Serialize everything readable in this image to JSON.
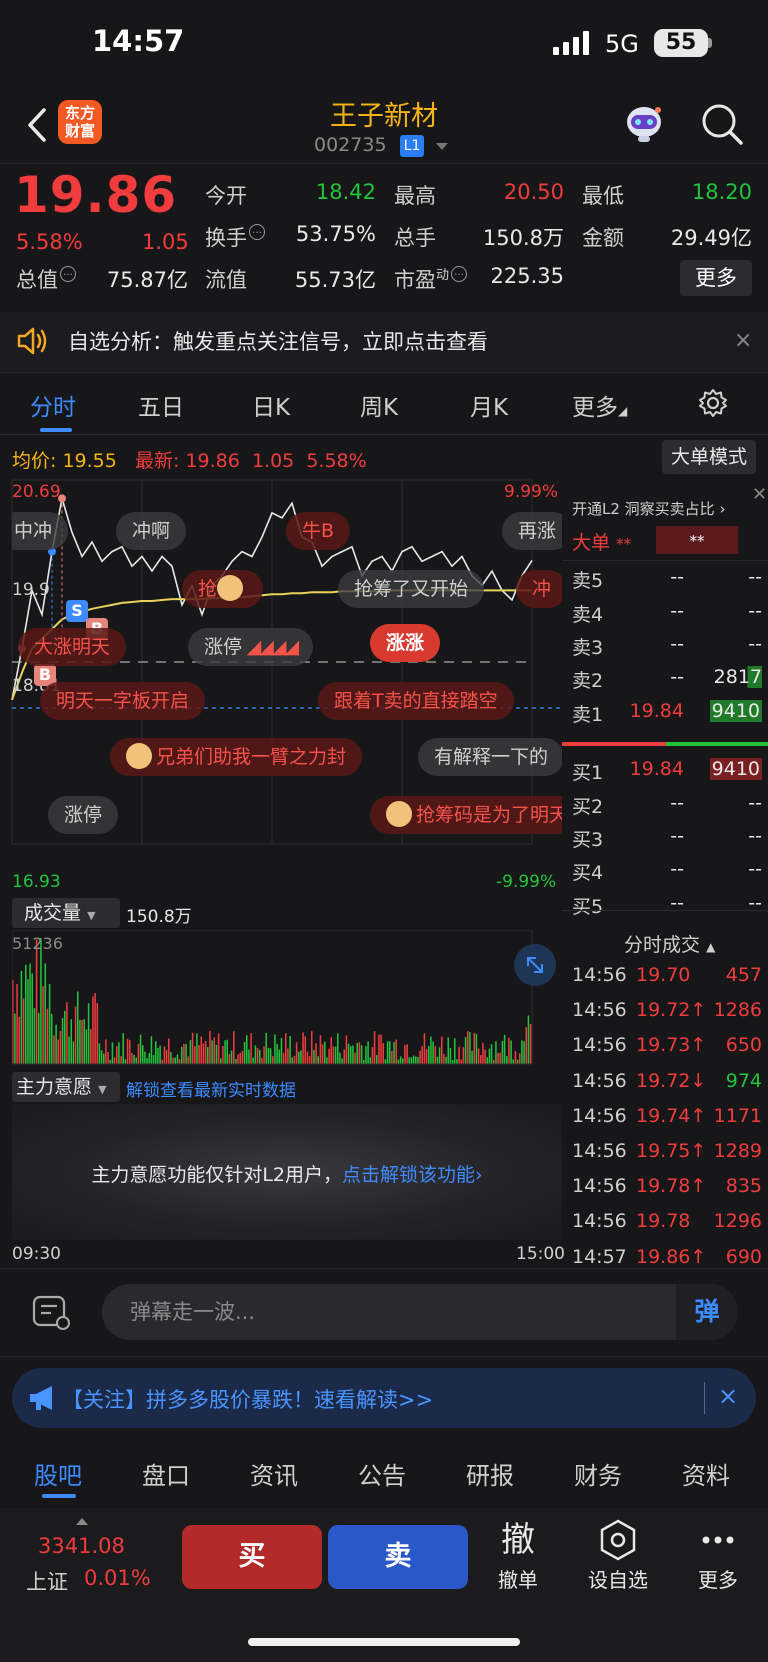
{
  "status_bar": {
    "time": "14:57",
    "network": "5G",
    "battery": "55"
  },
  "header": {
    "logo_text_1": "东方",
    "logo_text_2": "财富",
    "stock_name": "王子新材",
    "stock_code": "002735",
    "level_badge": "L1"
  },
  "quote": {
    "price": "19.86",
    "change_pct": "5.58%",
    "change": "1.05",
    "fields": [
      {
        "label": "今开",
        "value": "18.42"
      },
      {
        "label": "最高",
        "value": "20.50"
      },
      {
        "label": "最低",
        "value": "18.20"
      },
      {
        "label": "换手",
        "value": "53.75%"
      },
      {
        "label": "总手",
        "value": "150.8万"
      },
      {
        "label": "金额",
        "value": "29.49亿"
      },
      {
        "label": "总值",
        "value": "75.87亿"
      },
      {
        "label": "流值",
        "value": "55.73亿"
      },
      {
        "label": "市盈",
        "sup": "动",
        "value": "225.35"
      }
    ],
    "more_label": "更多"
  },
  "banner": {
    "text": "自选分析：触发重点关注信号，立即点击查看",
    "close": "×"
  },
  "chart_tabs": [
    "分时",
    "五日",
    "日K",
    "周K",
    "月K",
    "更多"
  ],
  "intraday": {
    "avg_label": "均价:",
    "avg_value": "19.55",
    "latest_label": "最新:",
    "latest_value": "19.86",
    "latest_change": "1.05",
    "latest_pct": "5.58%",
    "big_order_mode": "大单模式",
    "y_max": "20.69",
    "y_min": "16.93",
    "pct_max": "9.99%",
    "pct_min": "-9.99%",
    "y_mid": "19.9",
    "y_ref": "18.81",
    "time_start": "09:30",
    "time_end": "15:00",
    "markers": [
      "B",
      "S",
      "B"
    ]
  },
  "danmaku": [
    {
      "text": "中冲",
      "style": "gray"
    },
    {
      "text": "冲啊",
      "style": "gray"
    },
    {
      "text": "牛B",
      "style": "red"
    },
    {
      "text": "再涨",
      "style": "gray"
    },
    {
      "text": "抢",
      "style": "red"
    },
    {
      "text": "抢筹了又开始",
      "style": "gray"
    },
    {
      "text": "冲",
      "style": "red"
    },
    {
      "text": "大涨明天",
      "style": "red"
    },
    {
      "text": "涨停",
      "style": "gray"
    },
    {
      "text": "涨涨",
      "style": "red"
    },
    {
      "text": "明天一字板开启",
      "style": "red"
    },
    {
      "text": "跟着T卖的直接踏空",
      "style": "red"
    },
    {
      "text": "兄弟们助我一臂之力封",
      "style": "red"
    },
    {
      "text": "有解释一下的",
      "style": "gray"
    },
    {
      "text": "涨停",
      "style": "gray"
    },
    {
      "text": "抢筹码是为了明天",
      "style": "red"
    }
  ],
  "l2_panel": {
    "title": "开通L2 洞察买卖占比",
    "big_order_label": "大单",
    "big_order_v1": "**",
    "big_order_v2": "**"
  },
  "order_book": {
    "asks": [
      {
        "label": "卖5",
        "price": "--",
        "vol": "--"
      },
      {
        "label": "卖4",
        "price": "--",
        "vol": "--"
      },
      {
        "label": "卖3",
        "price": "--",
        "vol": "--"
      },
      {
        "label": "卖2",
        "price": "--",
        "vol": "2817"
      },
      {
        "label": "卖1",
        "price": "19.84",
        "vol": "9410"
      }
    ],
    "bids": [
      {
        "label": "买1",
        "price": "19.84",
        "vol": "9410"
      },
      {
        "label": "买2",
        "price": "--",
        "vol": "--"
      },
      {
        "label": "买3",
        "price": "--",
        "vol": "--"
      },
      {
        "label": "买4",
        "price": "--",
        "vol": "--"
      },
      {
        "label": "买5",
        "price": "--",
        "vol": "--"
      }
    ]
  },
  "ticks": {
    "title": "分时成交",
    "rows": [
      {
        "time": "14:56",
        "price": "19.70",
        "vol": "457",
        "pc": "red",
        "vc": "red"
      },
      {
        "time": "14:56",
        "price": "19.72↑",
        "vol": "1286",
        "pc": "red",
        "vc": "red"
      },
      {
        "time": "14:56",
        "price": "19.73↑",
        "vol": "650",
        "pc": "red",
        "vc": "red"
      },
      {
        "time": "14:56",
        "price": "19.72↓",
        "vol": "974",
        "pc": "red",
        "vc": "green"
      },
      {
        "time": "14:56",
        "price": "19.74↑",
        "vol": "1171",
        "pc": "red",
        "vc": "red"
      },
      {
        "time": "14:56",
        "price": "19.75↑",
        "vol": "1289",
        "pc": "red",
        "vc": "red"
      },
      {
        "time": "14:56",
        "price": "19.78↑",
        "vol": "835",
        "pc": "red",
        "vc": "red"
      },
      {
        "time": "14:56",
        "price": "19.78",
        "vol": "1296",
        "pc": "red",
        "vc": "red"
      },
      {
        "time": "14:57",
        "price": "19.86↑",
        "vol": "690",
        "pc": "red",
        "vc": "red"
      }
    ]
  },
  "volume": {
    "label": "成交量",
    "total": "150.8万",
    "max": "51236"
  },
  "main_force": {
    "label": "主力意愿",
    "link": "解锁查看最新实时数据",
    "locked_text": "主力意愿功能仅针对L2用户，",
    "unlock_link": "点击解锁该功能"
  },
  "danmu_input": {
    "placeholder": "弹幕走一波...",
    "send": "弹"
  },
  "ad": {
    "text": "【关注】拼多多股价暴跌！速看解读>>",
    "close": "×"
  },
  "bottom_tabs": [
    "股吧",
    "盘口",
    "资讯",
    "公告",
    "研报",
    "财务",
    "资料"
  ],
  "index": {
    "value": "3341.08",
    "name": "上证",
    "pct": "0.01%"
  },
  "actions": {
    "buy": "买",
    "sell": "卖",
    "cancel_icon": "撤",
    "cancel": "撤单",
    "watch": "设自选",
    "more": "更多"
  },
  "chart_data": {
    "type": "line",
    "x": [
      "09:30",
      "09:33",
      "09:36",
      "09:39",
      "09:42",
      "09:45",
      "09:48",
      "09:51",
      "09:54",
      "09:57",
      "10:00",
      "10:05",
      "10:10",
      "10:15",
      "10:20",
      "10:25",
      "10:30",
      "10:35",
      "10:40",
      "10:45",
      "10:50",
      "10:55",
      "11:00",
      "11:05",
      "11:10",
      "11:15",
      "11:20",
      "11:25",
      "11:30",
      "13:05",
      "13:10",
      "13:15",
      "13:20",
      "13:25",
      "13:30",
      "13:35",
      "13:40",
      "13:45",
      "13:50",
      "13:55",
      "14:00",
      "14:05",
      "14:10",
      "14:15",
      "14:20",
      "14:25",
      "14:30",
      "14:35",
      "14:40",
      "14:45",
      "14:50",
      "14:55",
      "15:00"
    ],
    "series": [
      {
        "values": [
          18.42,
          18.95,
          19.55,
          19.3,
          19.95,
          20.5,
          20.15,
          19.9,
          20.05,
          19.85,
          19.95,
          20.0,
          19.8,
          19.9,
          19.75,
          19.9,
          19.8,
          19.4,
          19.6,
          19.3,
          19.6,
          19.7,
          19.85,
          19.95,
          19.9,
          20.1,
          20.35,
          20.3,
          20.45,
          20.1,
          20.05,
          19.8,
          19.9,
          19.95,
          20.0,
          19.7,
          19.85,
          19.9,
          19.75,
          19.95,
          20.0,
          19.85,
          19.9,
          19.95,
          19.8,
          19.9,
          19.7,
          19.6,
          19.75,
          19.55,
          19.45,
          19.7,
          19.86
        ]
      },
      {
        "values": [
          18.42,
          18.7,
          18.95,
          19.05,
          19.15,
          19.25,
          19.3,
          19.33,
          19.36,
          19.38,
          19.4,
          19.42,
          19.43,
          19.44,
          19.44,
          19.45,
          19.46,
          19.46,
          19.46,
          19.46,
          19.47,
          19.47,
          19.48,
          19.48,
          19.49,
          19.5,
          19.51,
          19.51,
          19.52,
          19.52,
          19.53,
          19.53,
          19.53,
          19.54,
          19.54,
          19.54,
          19.54,
          19.54,
          19.55,
          19.55,
          19.55,
          19.55,
          19.55,
          19.55,
          19.55,
          19.55,
          19.55,
          19.55,
          19.55,
          19.55,
          19.55,
          19.55,
          19.55
        ]
      }
    ],
    "ylim": [
      16.93,
      20.69
    ],
    "ref_price": 18.81
  }
}
